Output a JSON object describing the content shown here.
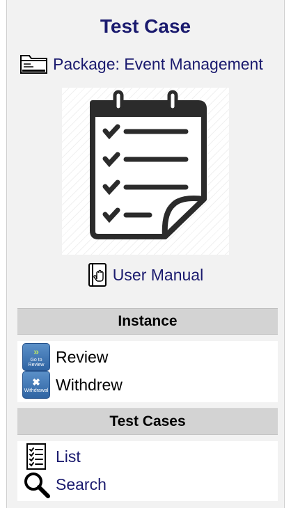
{
  "header": {
    "title": "Test Case"
  },
  "package": {
    "label": "Package: Event Management",
    "icon": "folder-icon"
  },
  "hero": {
    "icon": "checklist-clipboard-icon"
  },
  "manual": {
    "label": "User Manual",
    "icon": "manual-book-icon"
  },
  "instance": {
    "heading": "Instance",
    "actions": [
      {
        "label": "Review",
        "badge_caption": "Go to Review",
        "icon": "go-to-review-icon"
      },
      {
        "label": "Withdrew",
        "badge_caption": "Withdrawal",
        "icon": "withdrawal-icon"
      }
    ]
  },
  "test_cases": {
    "heading": "Test Cases",
    "links": [
      {
        "label": "List",
        "icon": "list-icon"
      },
      {
        "label": "Search",
        "icon": "search-icon"
      }
    ]
  },
  "colors": {
    "link": "#1a1a6e",
    "header_bg": "#d3d3d3",
    "panel_bg": "#f2f2f2",
    "badge": "#3d74b5"
  }
}
